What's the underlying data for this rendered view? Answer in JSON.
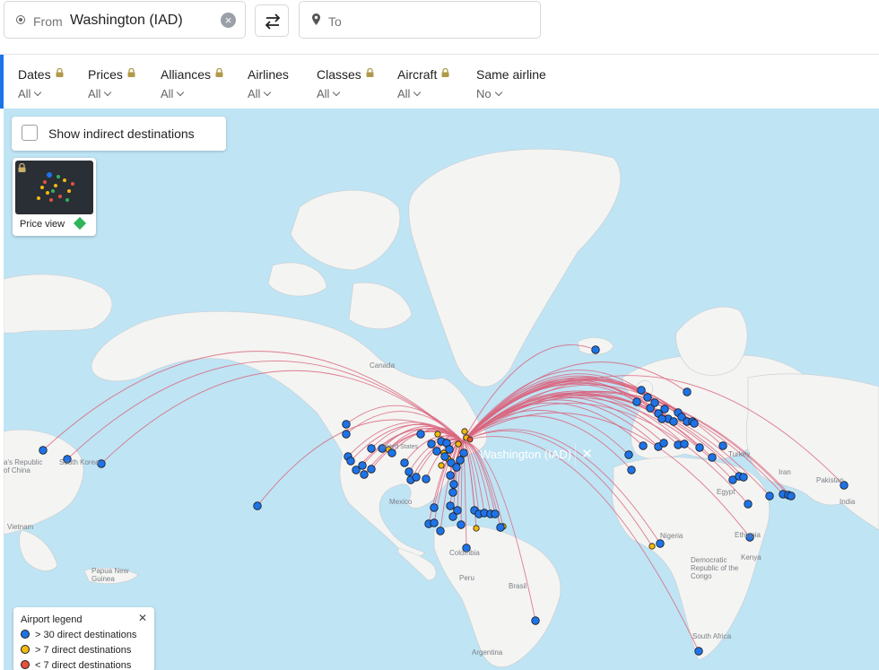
{
  "search": {
    "from_label": "From",
    "from_value": "Washington (IAD)",
    "to_placeholder": "To"
  },
  "filters": [
    {
      "label": "Dates",
      "value": "All",
      "locked": true
    },
    {
      "label": "Prices",
      "value": "All",
      "locked": true
    },
    {
      "label": "Alliances",
      "value": "All",
      "locked": true
    },
    {
      "label": "Airlines",
      "value": "All",
      "locked": false
    },
    {
      "label": "Classes",
      "value": "All",
      "locked": true
    },
    {
      "label": "Aircraft",
      "value": "All",
      "locked": true
    },
    {
      "label": "Same airline",
      "value": "No",
      "locked": false
    }
  ],
  "map": {
    "indirect_label": "Show indirect destinations",
    "price_view_label": "Price view",
    "tooltip": "Washington (IAD)",
    "geo_labels": [
      "Canada",
      "United States",
      "Mexico",
      "Colombia",
      "Peru",
      "Brasil",
      "Argentina",
      "Nigeria",
      "Ethiopia",
      "Kenya",
      "Democratic Republic of the Congo",
      "South Africa",
      "Egypt",
      "Turkey",
      "Iran",
      "Pakistan",
      "India",
      "Vietnam",
      "Papua New Guinea",
      "South Korea",
      "a's Republic",
      "of China"
    ]
  },
  "legend": {
    "title": "Airport legend",
    "items": [
      {
        "label": "> 30 direct destinations",
        "color": "#1e73e8"
      },
      {
        "label": "> 7 direct destinations",
        "color": "#f2b90f"
      },
      {
        "label": "< 7 direct destinations",
        "color": "#e8503a"
      }
    ]
  },
  "colors": {
    "accent": "#1e73e8",
    "route": "#d9667f",
    "water": "#bfe4f4",
    "land": "#f4f4f2"
  }
}
